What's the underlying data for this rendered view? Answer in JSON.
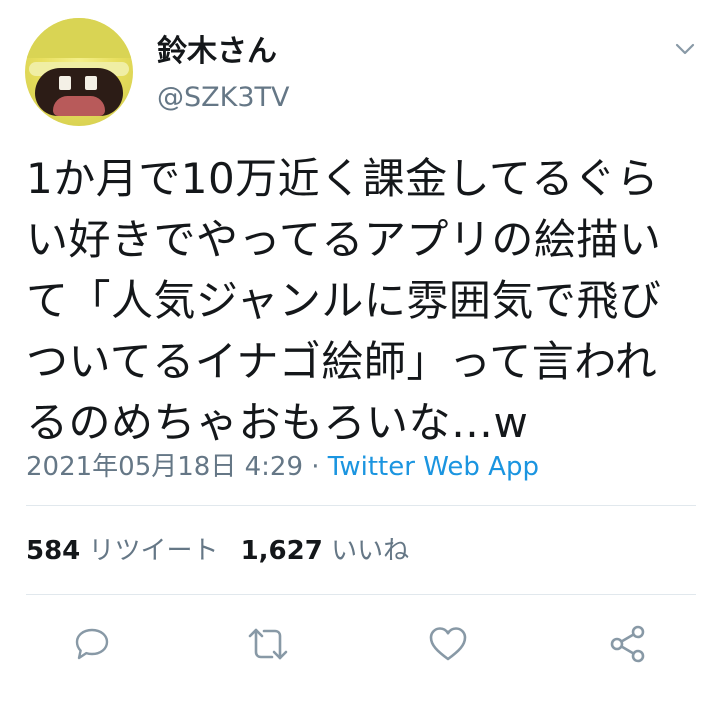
{
  "user": {
    "display_name": "鈴木さん",
    "handle": "@SZK3TV"
  },
  "tweet": {
    "text": "1か月で10万近く課金してるぐら\nい好きでやってるアプリの絵描い\nて「人気ジャンルに雰囲気で飛び\nついてるイナゴ絵師」って言われ\nるのめちゃおもろいな…w",
    "timestamp": "2021年05月18日 4:29",
    "separator": " · ",
    "source": "Twitter Web App"
  },
  "stats": {
    "retweets_count": "584",
    "retweets_label": "リツイート",
    "likes_count": "1,627",
    "likes_label": "いいね"
  },
  "icons": {
    "caret": "chevron-down-icon",
    "reply": "reply-icon",
    "retweet": "retweet-icon",
    "like": "heart-icon",
    "share": "share-icon"
  },
  "colors": {
    "text": "#14171a",
    "secondary": "#657786",
    "link": "#1b95e0",
    "divider": "#e1e8ed"
  }
}
